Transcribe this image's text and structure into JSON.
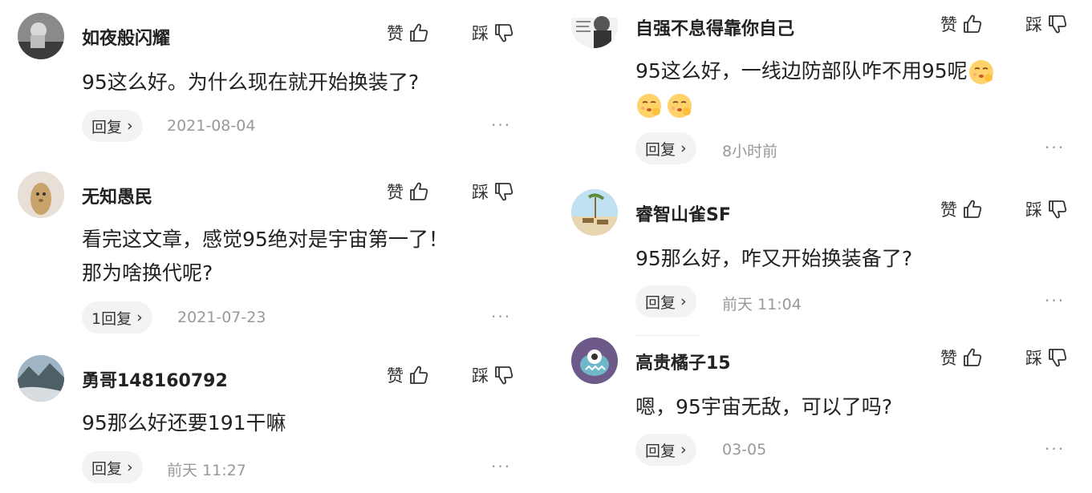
{
  "labels": {
    "like": "赞",
    "dislike": "踩",
    "more": "···",
    "reply_arrow": "›"
  },
  "comments_left": [
    {
      "user": "如夜般闪耀",
      "text": "95这么好。为什么现在就开始换装了?",
      "reply": "回复",
      "time": "2021-08-04"
    },
    {
      "user": "无知愚民",
      "text_line1": "看完这文章，感觉95绝对是宇宙第一了！",
      "text_line2": "那为啥换代呢?",
      "reply": "1回复",
      "time": "2021-07-23"
    },
    {
      "user": "勇哥148160792",
      "text": "95那么好还要191干嘛",
      "reply": "回复",
      "time": "前天 11:27"
    }
  ],
  "comments_right": [
    {
      "user": "自强不息得靠你自己",
      "text": "95这么好，一线边防部队咋不用95呢",
      "reply": "回复",
      "time": "8小时前"
    },
    {
      "user": "睿智山雀SF",
      "text": "95那么好，咋又开始换装备了?",
      "reply": "回复",
      "time": "前天 11:04"
    },
    {
      "user": "高贵橘子15",
      "text": "嗯，95宇宙无敌，可以了吗?",
      "reply": "回复",
      "time": "03-05"
    }
  ]
}
